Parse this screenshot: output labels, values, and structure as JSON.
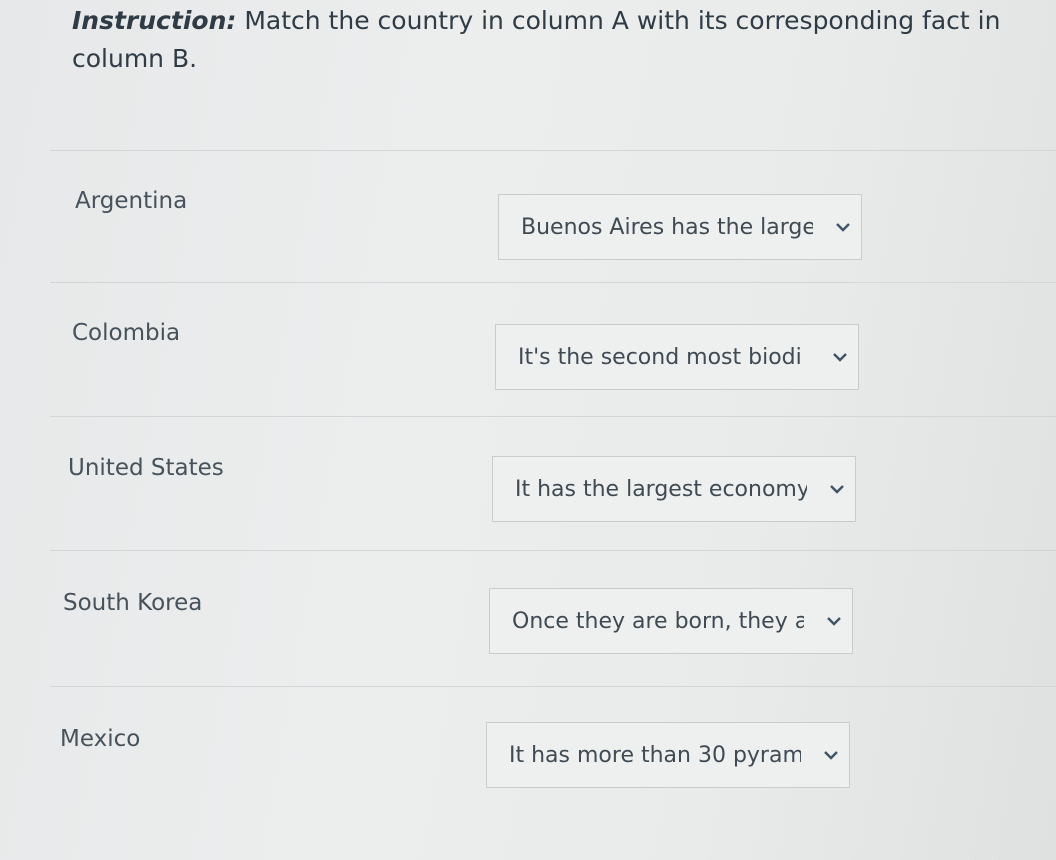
{
  "instruction": {
    "label": "Instruction:",
    "text": "Match the country in column A with its corresponding fact in column B."
  },
  "rows": [
    {
      "country": "Argentina",
      "selected": "Buenos Aires has the large"
    },
    {
      "country": "Colombia",
      "selected": "It's the second most biodi"
    },
    {
      "country": "United States",
      "selected": "It has the largest economy"
    },
    {
      "country": "South Korea",
      "selected": "Once they are born, they a"
    },
    {
      "country": "Mexico",
      "selected": "It has more than 30 pyram"
    }
  ],
  "icons": {
    "dropdown": "chevron-down-icon"
  }
}
